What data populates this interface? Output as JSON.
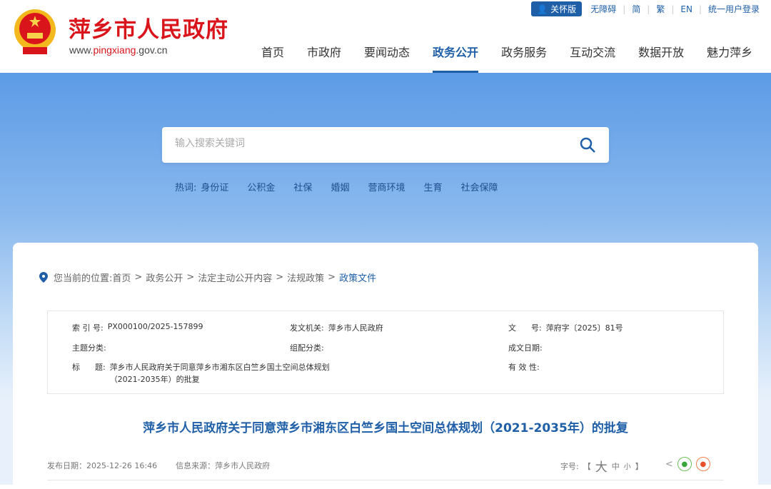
{
  "header": {
    "site_title": "萍乡市人民政府",
    "url_prefix": "www.",
    "url_mid": "pingxiang",
    "url_suffix": ".gov.cn"
  },
  "toplinks": {
    "care": "关怀版",
    "accessible": "无障碍",
    "simplified": "简",
    "traditional": "繁",
    "english": "EN",
    "login": "统一用户登录"
  },
  "nav": [
    "首页",
    "市政府",
    "要闻动态",
    "政务公开",
    "政务服务",
    "互动交流",
    "数据开放",
    "魅力萍乡"
  ],
  "search": {
    "placeholder": "输入搜索关键词"
  },
  "hot": {
    "label": "热词:",
    "words": [
      "身份证",
      "公积金",
      "社保",
      "婚姻",
      "营商环境",
      "生育",
      "社会保障"
    ]
  },
  "breadcrumb": {
    "label": "您当前的位置:",
    "items": [
      "首页",
      "政务公开",
      "法定主动公开内容",
      "法规政策",
      "政策文件"
    ],
    "sep": ">"
  },
  "info": {
    "index_label": "索 引 号:",
    "index": "PX000100/2025-157899",
    "issuer_label": "发文机关:",
    "issuer": "萍乡市人民政府",
    "docno_label": "文      号:",
    "docno": "萍府字〔2025〕81号",
    "topic_label": "主题分类:",
    "combo_label": "组配分类:",
    "date_label": "成文日期:",
    "title_label": "标      题:",
    "title_line1": "萍乡市人民政府关于同意萍乡市湘东区白竺乡国土空间总体规划",
    "title_line2": "（2021-2035年）的批复",
    "valid_label": "有 效 性:"
  },
  "doc_title": "萍乡市人民政府关于同意萍乡市湘东区白竺乡国土空间总体规划（2021-2035年）的批复",
  "meta": {
    "publish": "发布日期：2025-12-26 16:46",
    "source": "信息来源：萍乡市人民政府"
  },
  "font_size": {
    "label": "字号:",
    "open": "【",
    "large": "大",
    "medium": "中",
    "small": "小",
    "close": "】"
  },
  "colors": {
    "brand": "#1f5fa8",
    "red": "#d9151b"
  }
}
